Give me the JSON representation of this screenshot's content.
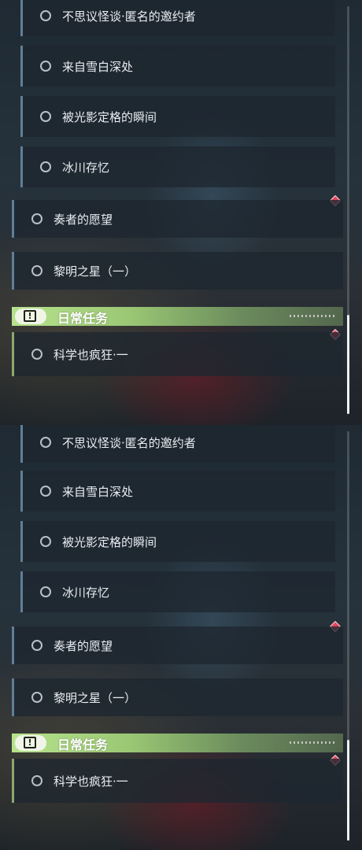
{
  "quests": {
    "sub_items": [
      "不思议怪谈·匿名的邀约者",
      "来自雪白深处",
      "被光影定格的瞬间",
      "冰川存忆"
    ],
    "main_items": [
      "奏者的愿望",
      "黎明之星（一）"
    ]
  },
  "daily": {
    "header_title": "日常任务",
    "header_icon_glyph": "!",
    "items": [
      "科学也疯狂·一"
    ]
  },
  "colors": {
    "accent_green": "#b7e38d",
    "quest_border": "#5f7f99",
    "new_badge": "#e0465a"
  },
  "icons": [
    "circle-icon",
    "exclamation-box-icon",
    "diamond-badge-icon"
  ]
}
